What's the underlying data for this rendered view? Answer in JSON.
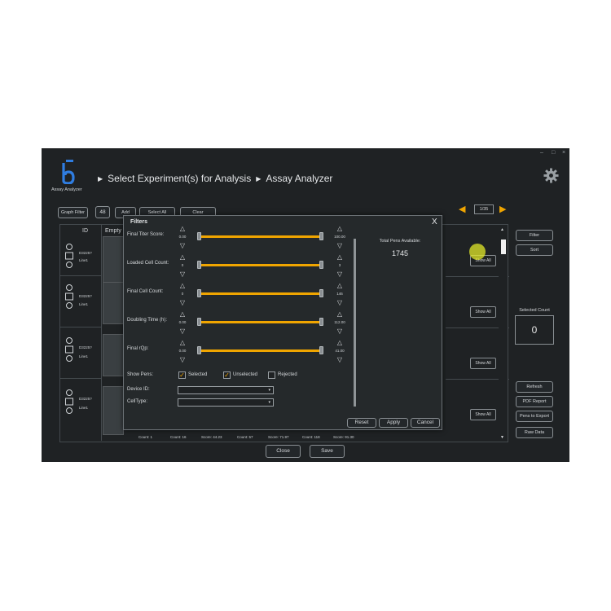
{
  "window": {
    "controls": [
      "–",
      "□",
      "×"
    ]
  },
  "app": {
    "name": "Assay Analyzer"
  },
  "breadcrumb": [
    "Select Experiment(s) for Analysis",
    "Assay Analyzer"
  ],
  "toolbar": {
    "graph_filter": "Graph Filter",
    "count": "48",
    "add": "Add",
    "select_all": "Select All",
    "clear": "Clear"
  },
  "pager": {
    "page": "1/35"
  },
  "grid": {
    "headers": {
      "id": "ID",
      "empty": "Empty"
    },
    "rows": [
      {
        "id": "D3225?",
        "line": "Line1"
      },
      {
        "id": "D3225?",
        "line": "Line1"
      },
      {
        "id": "D3225?",
        "line": "Line1"
      },
      {
        "id": "D3225?",
        "line": "Line1"
      }
    ],
    "show_all": "Show All",
    "footer": [
      "Count: 1",
      "Count: 16",
      "Score: 44.23",
      "Count: 57",
      "Score: 71.97",
      "Count: 118",
      "Score: 91.30"
    ]
  },
  "side": {
    "filter": "Filter",
    "sort": "Sort",
    "selected_count_label": "Selected Count",
    "selected_count": "0",
    "refresh": "Refresh",
    "pdf_report": "PDF Report",
    "pens_to_export": "Pens to Export",
    "raw_data": "Raw Data"
  },
  "bottom": {
    "close": "Close",
    "save": "Save"
  },
  "filters": {
    "title": "Filters",
    "close": "X",
    "ranges": [
      {
        "label": "Final Titer Score:",
        "min": "0.00",
        "max": "100.00",
        "low": 0.0,
        "high": 1.0
      },
      {
        "label": "Loaded Cell Count:",
        "min": "0",
        "max": "3",
        "low": 0.0,
        "high": 1.0
      },
      {
        "label": "Final Cell Count:",
        "min": "0",
        "max": "146",
        "low": 0.0,
        "high": 1.0
      },
      {
        "label": "Doubling Time (h):",
        "min": "0.00",
        "max": "112.00",
        "low": 0.0,
        "high": 1.0
      },
      {
        "label": "Final rQp:",
        "min": "0.00",
        "max": "41.00",
        "low": 0.0,
        "high": 1.0
      }
    ],
    "show_pens": {
      "label": "Show Pens:",
      "selected": "Selected",
      "unselected": "Unselected",
      "rejected": "Rejected"
    },
    "device_id": {
      "label": "Device ID:",
      "value": ""
    },
    "cell_type": {
      "label": "CellType:",
      "value": ""
    },
    "total_label": "Total Pens Available:",
    "total": "1745",
    "reset": "Reset",
    "apply": "Apply",
    "cancel": "Cancel"
  },
  "colors": {
    "accent": "#f0a500",
    "background": "#1f2224",
    "logo_blue": "#2f7de1"
  }
}
